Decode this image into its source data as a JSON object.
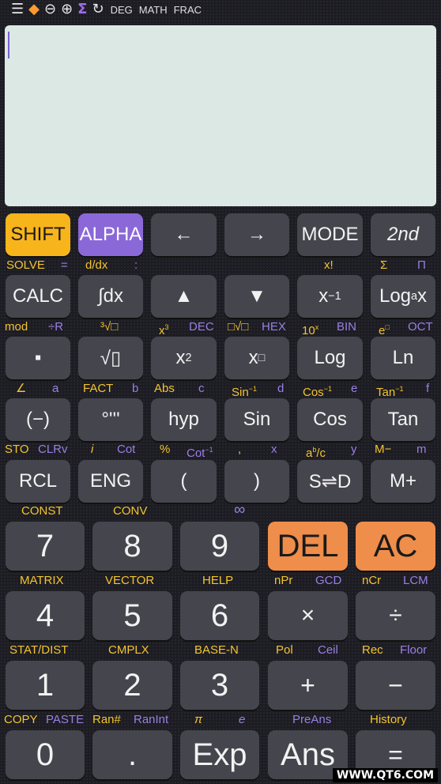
{
  "status_bar": {
    "deg": "DEG",
    "math": "MATH",
    "frac": "FRAC"
  },
  "row1": {
    "shift": "SHIFT",
    "alpha": "ALPHA",
    "left": "←",
    "right": "→",
    "mode": "MODE",
    "second": "2nd"
  },
  "row1_labels": {
    "solve": "SOLVE",
    "eq": "=",
    "ddx": "d/dx",
    "colon": ":",
    "xfact": "x!",
    "sum": "Σ",
    "prod": "Π"
  },
  "row2": {
    "calc": "CALC",
    "int": "∫dx",
    "up": "▲",
    "down": "▼",
    "xinv_base": "x",
    "xinv_sup": "−1",
    "log_base": "Log",
    "log_sub": "a",
    "log_x": "x"
  },
  "row2_labels": {
    "mod": "mod",
    "divr": "÷R",
    "cbrt": "³√□",
    "x3_base": "x",
    "x3_sup": "3",
    "dec": "DEC",
    "nrt": "□√□",
    "hex": "HEX",
    "tenx_base": "10",
    "tenx_sup": "x",
    "bin": "BIN",
    "ex_base": "e",
    "ex_sup": "□",
    "oct": "OCT"
  },
  "row3": {
    "frac": "▪",
    "sqrt": "√▯",
    "x2_base": "x",
    "x2_sup": "2",
    "xbox_base": "x",
    "xbox_sup": "□",
    "log": "Log",
    "ln": "Ln"
  },
  "row3_labels": {
    "angle": "∠",
    "a": "a",
    "fact": "FACT",
    "b": "b",
    "abs": "Abs",
    "c": "c",
    "asin_base": "Sin",
    "asin_sup": "−1",
    "d": "d",
    "acos_base": "Cos",
    "acos_sup": "−1",
    "e": "e",
    "atan_base": "Tan",
    "atan_sup": "−1",
    "f": "f"
  },
  "row4": {
    "neg": "(−)",
    "dms": "°'''",
    "hyp": "hyp",
    "sin": "Sin",
    "cos": "Cos",
    "tan": "Tan"
  },
  "row4_labels": {
    "sto": "STO",
    "clrv": "CLRv",
    "i": "i",
    "cot": "Cot",
    "pct": "%",
    "acot_base": "Cot",
    "acot_sup": "−1",
    "comma": ",",
    "x": "x",
    "abc": "a",
    "abc_sup": "b",
    "abc_rest": "/c",
    "y": "y",
    "mminus": "M−",
    "m": "m"
  },
  "row5": {
    "rcl": "RCL",
    "eng": "ENG",
    "lparen": "(",
    "rparen": ")",
    "sd": "S⇌D",
    "mplus": "M+"
  },
  "row5_labels": {
    "const": "CONST",
    "conv": "CONV",
    "inf": "∞"
  },
  "row6": {
    "k7": "7",
    "k8": "8",
    "k9": "9",
    "del": "DEL",
    "ac": "AC"
  },
  "row6_labels": {
    "matrix": "MATRIX",
    "vector": "VECTOR",
    "help": "HELP",
    "npr": "nPr",
    "gcd": "GCD",
    "ncr": "nCr",
    "lcm": "LCM"
  },
  "row7": {
    "k4": "4",
    "k5": "5",
    "k6": "6",
    "mul": "×",
    "div": "÷"
  },
  "row7_labels": {
    "stat": "STAT/DIST",
    "cmplx": "CMPLX",
    "basen": "BASE-N",
    "pol": "Pol",
    "ceil": "Ceil",
    "rec": "Rec",
    "floor": "Floor"
  },
  "row8": {
    "k1": "1",
    "k2": "2",
    "k3": "3",
    "plus": "+",
    "minus": "−"
  },
  "row8_labels": {
    "copy": "COPY",
    "paste": "PASTE",
    "ran": "Ran#",
    "ranint": "RanInt",
    "pi": "π",
    "econst": "e",
    "preans": "PreAns",
    "history": "History"
  },
  "row9": {
    "k0": "0",
    "dot": ".",
    "exp": "Exp",
    "ans": "Ans",
    "equals": "="
  },
  "watermark": "WWW.QT6.COM",
  "colors": {
    "shift": "#f8b41b",
    "alpha": "#8b68d8",
    "orange": "#ef8d4b",
    "key": "#45454d",
    "display": "#dce8e4",
    "label_yellow": "#f4c430",
    "label_purple": "#9b7fe6"
  }
}
